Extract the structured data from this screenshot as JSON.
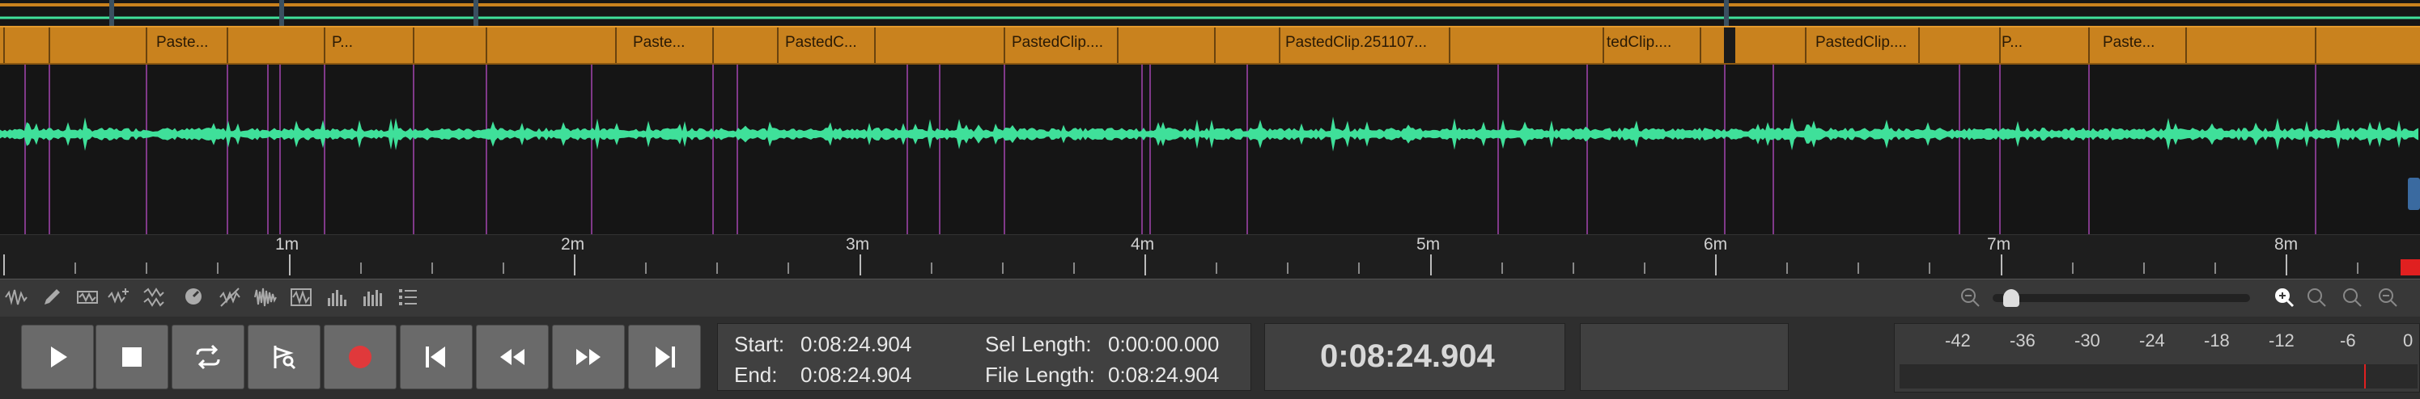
{
  "clips": [
    {
      "label": "Paste..."
    },
    {
      "label": "P..."
    },
    {
      "label": "Paste..."
    },
    {
      "label": "PastedC..."
    },
    {
      "label": "PastedClip...."
    },
    {
      "label": "PastedClip.251107..."
    },
    {
      "label": "tedClip...."
    },
    {
      "label": "PastedClip...."
    },
    {
      "label": "P..."
    },
    {
      "label": "Paste..."
    }
  ],
  "ruler": {
    "ticks": [
      "1m",
      "2m",
      "3m",
      "4m",
      "5m",
      "6m",
      "7m",
      "8m"
    ]
  },
  "transport": {
    "buttons": [
      "play",
      "stop",
      "loop",
      "scrub",
      "record",
      "go-to-start",
      "rewind",
      "fast-forward",
      "go-to-end"
    ],
    "record_color": "#e0393b"
  },
  "selection": {
    "start_label": "Start:",
    "start_value": "0:08:24.904",
    "end_label": "End:",
    "end_value": "0:08:24.904",
    "sel_length_label": "Sel Length:",
    "sel_length_value": "0:00:00.000",
    "file_length_label": "File Length:",
    "file_length_value": "0:08:24.904"
  },
  "current_time": "0:08:24.904",
  "meter": {
    "scale": [
      "-42",
      "-36",
      "-30",
      "-24",
      "-18",
      "-12",
      "-6",
      "0"
    ]
  },
  "colors": {
    "clip": "#c9821e",
    "waveform": "#3fe09a",
    "marker": "#8c3d96"
  },
  "zoom": {
    "level_fraction": 0.01
  }
}
